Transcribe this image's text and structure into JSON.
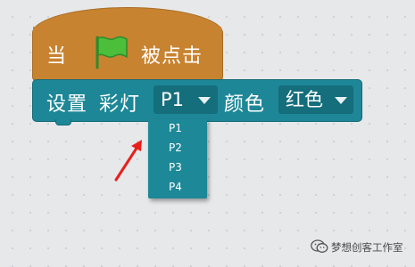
{
  "hat_block": {
    "prefix": "当",
    "icon": "green-flag-icon",
    "suffix": "被点击",
    "color": "#c88330"
  },
  "set_block": {
    "set_label": "设置",
    "light_label": "彩灯",
    "port_value": "P1",
    "color_label": "颜色",
    "color_value": "红色",
    "color": "#1e8797"
  },
  "port_menu": {
    "options": [
      "P1",
      "P2",
      "P3",
      "P4"
    ]
  },
  "annotation": {
    "arrow_color": "#e8201c"
  },
  "watermark": {
    "text": "梦想创客工作室"
  }
}
